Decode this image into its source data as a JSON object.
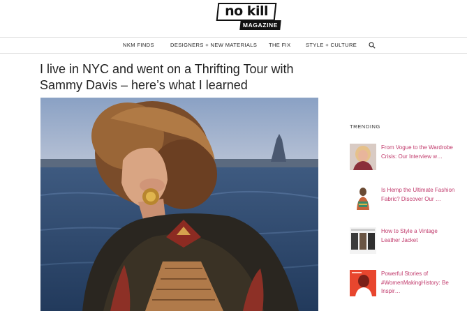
{
  "logo": {
    "top_text": "no kill",
    "bottom_text": "MAGAZINE"
  },
  "nav": {
    "items": [
      {
        "label": "NKM FINDS"
      },
      {
        "label": "DESIGNERS + NEW MATERIALS"
      },
      {
        "label": "THE FIX"
      },
      {
        "label": "STYLE + CULTURE"
      }
    ],
    "search_icon": "search-icon"
  },
  "article": {
    "title": "I live in NYC and went on a Thrifting Tour with Sammy Davis – here’s what I learned"
  },
  "sidebar": {
    "trending_label": "TRENDING",
    "items": [
      {
        "title": "From Vogue to the Wardrobe Crisis: Our Interview w…"
      },
      {
        "title": "Is Hemp the Ultimate Fashion Fabric? Discover Our …"
      },
      {
        "title": "How to Style a Vintage Leather Jacket"
      },
      {
        "title": "Powerful Stories of #WomenMakingHistory: Be Inspir…"
      }
    ]
  },
  "colors": {
    "accent_link": "#c0396b",
    "text": "#222222",
    "divider": "#e2e2e2"
  }
}
